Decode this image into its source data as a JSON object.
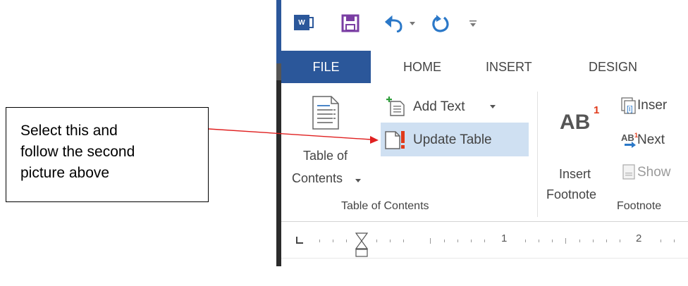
{
  "callout": {
    "lines": [
      "Select this and",
      "follow the second",
      "picture above"
    ]
  },
  "quick_access": {
    "word_icon": "word-app-icon",
    "save_icon": "save-icon",
    "undo_icon": "undo-icon",
    "redo_icon": "repeat-icon",
    "customize_icon": "customize-qat-icon"
  },
  "tabs": {
    "file": "FILE",
    "home": "HOME",
    "insert": "INSERT",
    "design": "DESIGN"
  },
  "ribbon": {
    "toc": {
      "label_line1": "Table of",
      "label_line2": "Contents",
      "add_text": "Add Text",
      "update_table": "Update Table",
      "group_label": "Table of Contents"
    },
    "footnotes": {
      "insert_line1": "Insert",
      "insert_line2": "Footnote",
      "insert_endnote": "Inser",
      "next_footnote": "Next",
      "show_notes": "Show",
      "group_label": "Footnote"
    }
  },
  "ruler": {
    "marks": [
      "1",
      "2"
    ]
  },
  "colors": {
    "accent": "#2b579a",
    "highlight": "#cfe0f2",
    "arrow": "#e02020"
  }
}
